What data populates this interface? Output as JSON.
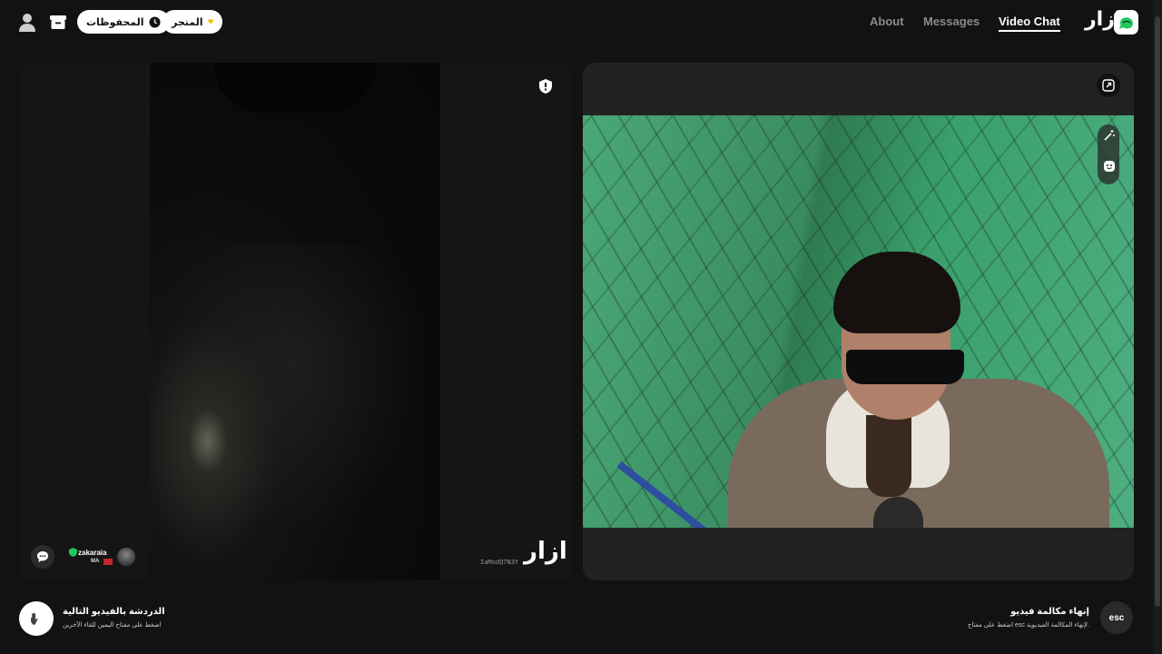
{
  "header": {
    "logo_text": "ازار",
    "nav": [
      {
        "label": "Video Chat",
        "active": true
      },
      {
        "label": "Messages",
        "active": false
      },
      {
        "label": "About",
        "active": false
      }
    ],
    "shop_label": "المتجر",
    "saved_label": "المحفوظات"
  },
  "remote": {
    "watermark_logo": "ازار",
    "watermark_id": "IaModQ7N3Y",
    "user": {
      "name": "zakaraia",
      "country": "MA",
      "verified": true
    }
  },
  "footer": {
    "next": {
      "title": "الدردشة بالفيديو التالية",
      "hint": "اضغط على مفتاح اليمين للقاء الآخرين"
    },
    "end": {
      "key": "esc",
      "title": "إنهاء مكالمة فيديو",
      "hint": "اضغط على مفتاح esc لإنهاء المكالمة الفيديوية."
    }
  },
  "colors": {
    "background": "#121212",
    "panel": "#222222",
    "accent_green": "#22c55e",
    "flag_red": "#c1272d"
  }
}
